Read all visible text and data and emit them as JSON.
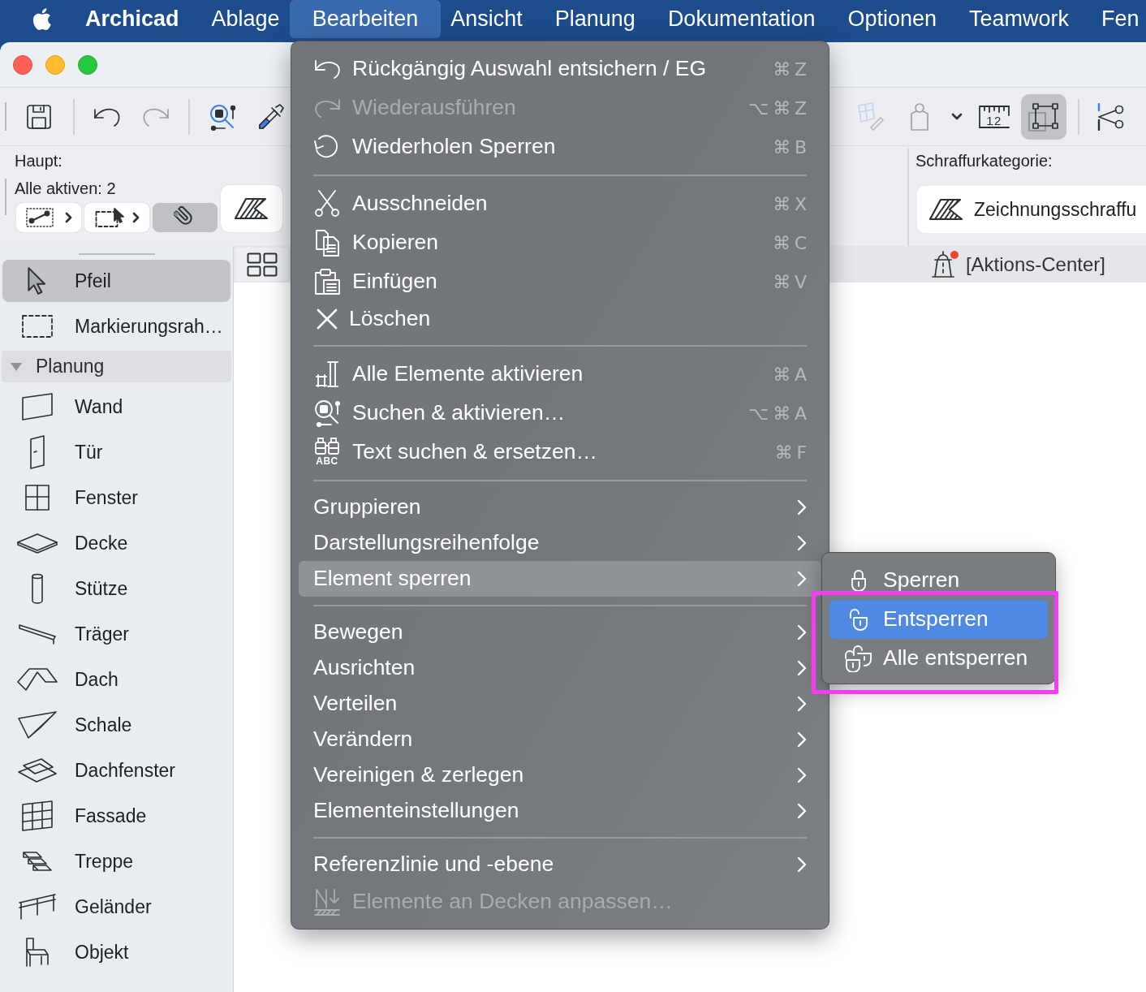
{
  "menubar": {
    "items": [
      {
        "label": "Archicad",
        "kind": "app",
        "selected": false
      },
      {
        "label": "Ablage",
        "kind": "menu",
        "selected": false
      },
      {
        "label": "Bearbeiten",
        "kind": "menu",
        "selected": true
      },
      {
        "label": "Ansicht",
        "kind": "menu",
        "selected": false
      },
      {
        "label": "Planung",
        "kind": "menu",
        "selected": false
      },
      {
        "label": "Dokumentation",
        "kind": "menu",
        "selected": false
      },
      {
        "label": "Optionen",
        "kind": "menu",
        "selected": false
      },
      {
        "label": "Teamwork",
        "kind": "menu",
        "selected": false
      },
      {
        "label": "Fen",
        "kind": "menu",
        "selected": false
      }
    ]
  },
  "toolbar": {
    "left": [
      {
        "disabled": false,
        "selected": false
      },
      {
        "disabled": false,
        "selected": false
      },
      {
        "disabled": true,
        "selected": false
      },
      {
        "disabled": false,
        "selected": false
      },
      {
        "disabled": false,
        "selected": false
      }
    ],
    "right": [
      {
        "disabled": true,
        "selected": false
      },
      {
        "disabled": true,
        "selected": false
      },
      {
        "disabled": false,
        "selected": false
      },
      {
        "disabled": false,
        "selected": false,
        "caption": "12"
      },
      {
        "disabled": false,
        "selected": true
      },
      {
        "disabled": false,
        "selected": false
      }
    ]
  },
  "info_box": {
    "title": "Haupt:",
    "status": "Alle aktiven: 2",
    "tools": [
      {
        "selected": false
      },
      {
        "selected": false
      },
      {
        "selected": true
      },
      {
        "selected": false
      }
    ],
    "hatch_label": "Schraffurkategorie:",
    "hatch_value": "Zeichnungsschraffu"
  },
  "panel_bar": {
    "action_center": "[Aktions-Center]",
    "notification": true
  },
  "sidebar": {
    "items": [
      {
        "label": "Pfeil",
        "selected": true
      },
      {
        "label": "Markierungsrah…",
        "selected": false
      }
    ],
    "sections": [
      {
        "label": "Planung",
        "expanded": true,
        "items": [
          {
            "label": "Wand",
            "selected": false
          },
          {
            "label": "Tür",
            "selected": false
          },
          {
            "label": "Fenster",
            "selected": false
          },
          {
            "label": "Decke",
            "selected": false
          },
          {
            "label": "Stütze",
            "selected": false
          },
          {
            "label": "Träger",
            "selected": false
          },
          {
            "label": "Dach",
            "selected": false
          },
          {
            "label": "Schale",
            "selected": false
          },
          {
            "label": "Dachfenster",
            "selected": false
          },
          {
            "label": "Fassade",
            "selected": false
          },
          {
            "label": "Treppe",
            "selected": false
          },
          {
            "label": "Geländer",
            "selected": false
          },
          {
            "label": "Objekt",
            "selected": false
          }
        ]
      }
    ]
  },
  "menu": {
    "groups": [
      [
        {
          "label": "Rückgängig Auswahl entsichern / EG",
          "shortcut": "⌘Z",
          "disabled": false,
          "submenu": false,
          "selected": false
        },
        {
          "label": "Wiederausführen",
          "shortcut": "⌥⌘Z",
          "disabled": true,
          "submenu": false,
          "selected": false
        },
        {
          "label": "Wiederholen Sperren",
          "shortcut": "⌘B",
          "disabled": false,
          "submenu": false,
          "selected": false
        }
      ],
      [
        {
          "label": "Ausschneiden",
          "shortcut": "⌘X",
          "disabled": false,
          "submenu": false,
          "selected": false
        },
        {
          "label": "Kopieren",
          "shortcut": "⌘C",
          "disabled": false,
          "submenu": false,
          "selected": false
        },
        {
          "label": "Einfügen",
          "shortcut": "⌘V",
          "disabled": false,
          "submenu": false,
          "selected": false
        },
        {
          "label": "Löschen",
          "disabled": false,
          "submenu": false,
          "selected": false
        }
      ],
      [
        {
          "label": "Alle Elemente aktivieren",
          "shortcut": "⌘A",
          "disabled": false,
          "submenu": false,
          "selected": false
        },
        {
          "label": "Suchen & aktivieren…",
          "shortcut": "⌥⌘A",
          "disabled": false,
          "submenu": false,
          "selected": false
        },
        {
          "label": "Text suchen & ersetzen…",
          "shortcut": "⌘F",
          "icon_caption": "ABC",
          "disabled": false,
          "submenu": false,
          "selected": false
        }
      ],
      [
        {
          "label": "Gruppieren",
          "disabled": false,
          "submenu": true,
          "selected": false
        },
        {
          "label": "Darstellungsreihenfolge",
          "disabled": false,
          "submenu": true,
          "selected": false
        },
        {
          "label": "Element sperren",
          "disabled": false,
          "submenu": true,
          "selected": true
        }
      ],
      [
        {
          "label": "Bewegen",
          "disabled": false,
          "submenu": true,
          "selected": false
        },
        {
          "label": "Ausrichten",
          "disabled": false,
          "submenu": true,
          "selected": false
        },
        {
          "label": "Verteilen",
          "disabled": false,
          "submenu": true,
          "selected": false
        },
        {
          "label": "Verändern",
          "disabled": false,
          "submenu": true,
          "selected": false
        },
        {
          "label": "Vereinigen & zerlegen",
          "disabled": false,
          "submenu": true,
          "selected": false
        },
        {
          "label": "Elementeinstellungen",
          "disabled": false,
          "submenu": true,
          "selected": false
        }
      ],
      [
        {
          "label": "Referenzlinie und -ebene",
          "disabled": false,
          "submenu": true,
          "selected": false
        },
        {
          "label": "Elemente an Decken anpassen…",
          "disabled": true,
          "submenu": false,
          "selected": false
        }
      ]
    ]
  },
  "submenu": {
    "items": [
      {
        "label": "Sperren",
        "selected": false,
        "annotated": false
      },
      {
        "label": "Entsperren",
        "selected": true,
        "annotated": true
      },
      {
        "label": "Alle entsperren",
        "selected": false,
        "annotated": true
      }
    ]
  }
}
